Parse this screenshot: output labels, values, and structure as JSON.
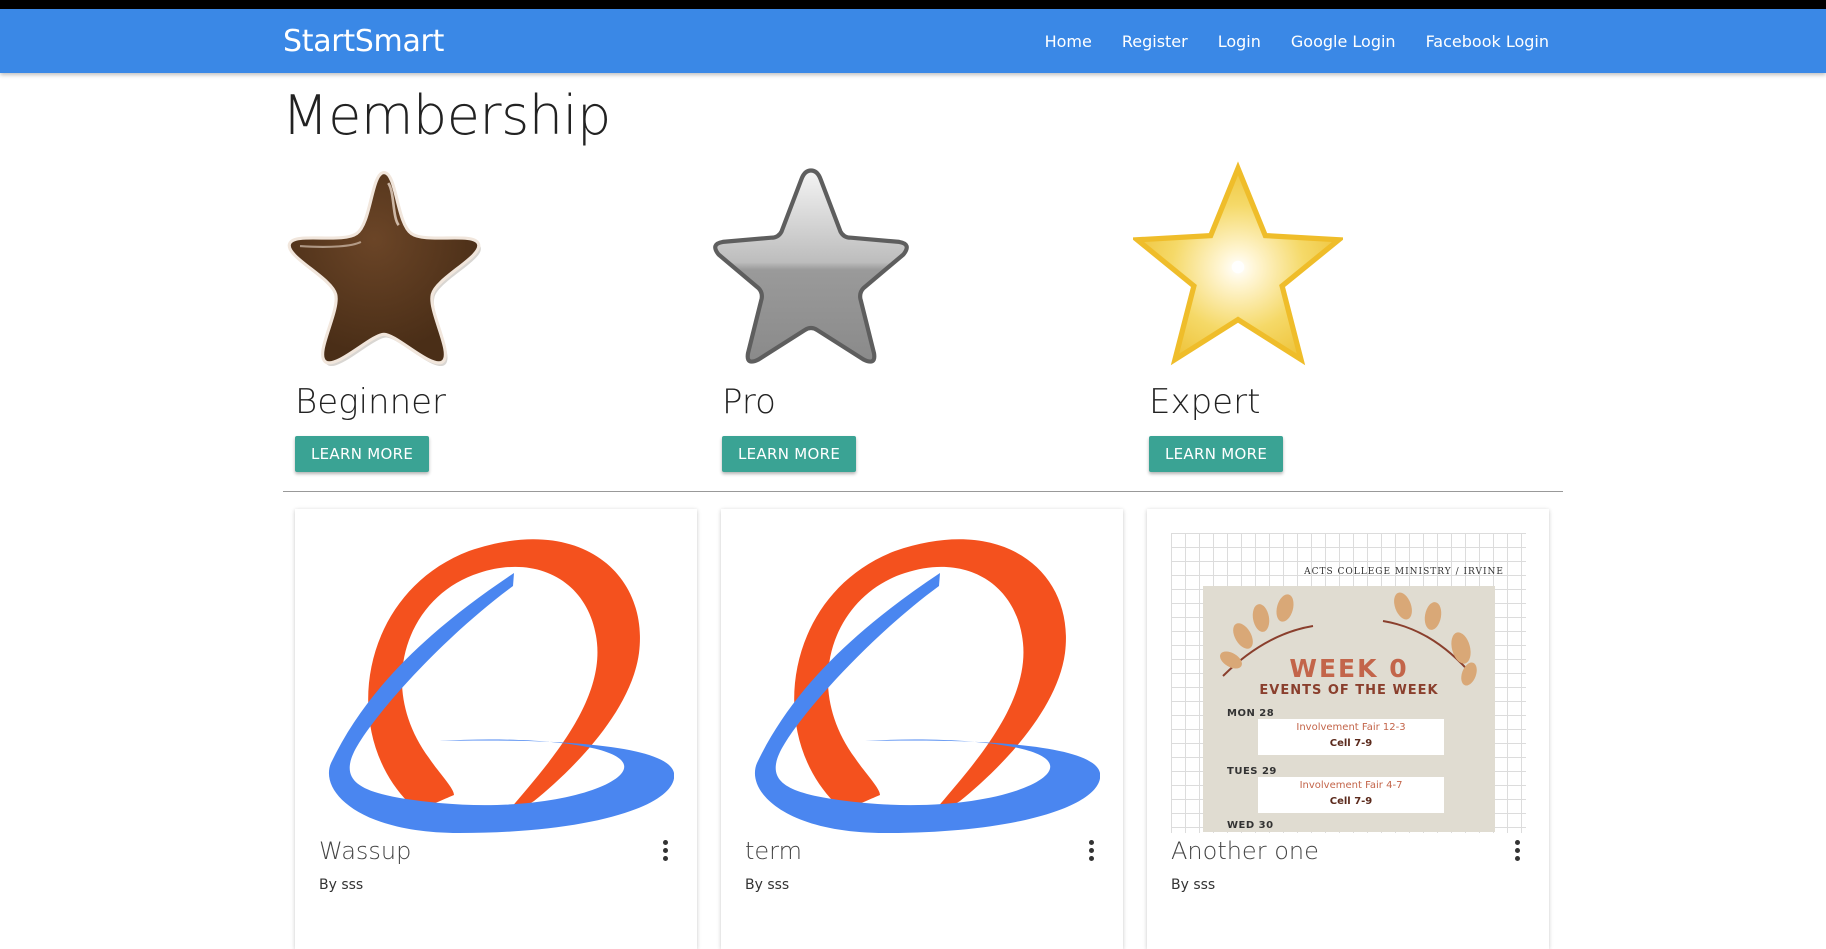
{
  "navbar": {
    "brand": "StartSmart",
    "links": [
      "Home",
      "Register",
      "Login",
      "Google Login",
      "Facebook Login"
    ]
  },
  "page": {
    "title": "Membership"
  },
  "tiers": [
    {
      "name": "Beginner",
      "button": "LEARN MORE",
      "icon": "bronze-star-icon",
      "color": "#55361f"
    },
    {
      "name": "Pro",
      "button": "LEARN MORE",
      "icon": "silver-star-icon",
      "color": "#9a9a9a"
    },
    {
      "name": "Expert",
      "button": "LEARN MORE",
      "icon": "gold-star-icon",
      "color": "#f2c935"
    }
  ],
  "cards": [
    {
      "title": "Wassup",
      "author": "By sss",
      "image": "swirl-logo"
    },
    {
      "title": "term",
      "author": "By sss",
      "image": "swirl-logo"
    },
    {
      "title": "Another one",
      "author": "By sss",
      "image": "week-0-poster",
      "poster": {
        "ministry": "ACTS COLLEGE MINISTRY / IRVINE",
        "headline": "WEEK 0",
        "subheadline": "EVENTS OF THE WEEK",
        "days": [
          {
            "label": "MON 28",
            "event": "Involvement Fair 12-3",
            "cell": "Cell 7-9"
          },
          {
            "label": "TUES 29",
            "event": "Involvement Fair 4-7",
            "cell": "Cell 7-9"
          },
          {
            "label": "WED 30"
          }
        ]
      }
    }
  ],
  "colors": {
    "navbar": "#3a88e6",
    "button": "#3aa394",
    "logo_orange": "#f4511e",
    "logo_blue": "#4a86f0"
  }
}
